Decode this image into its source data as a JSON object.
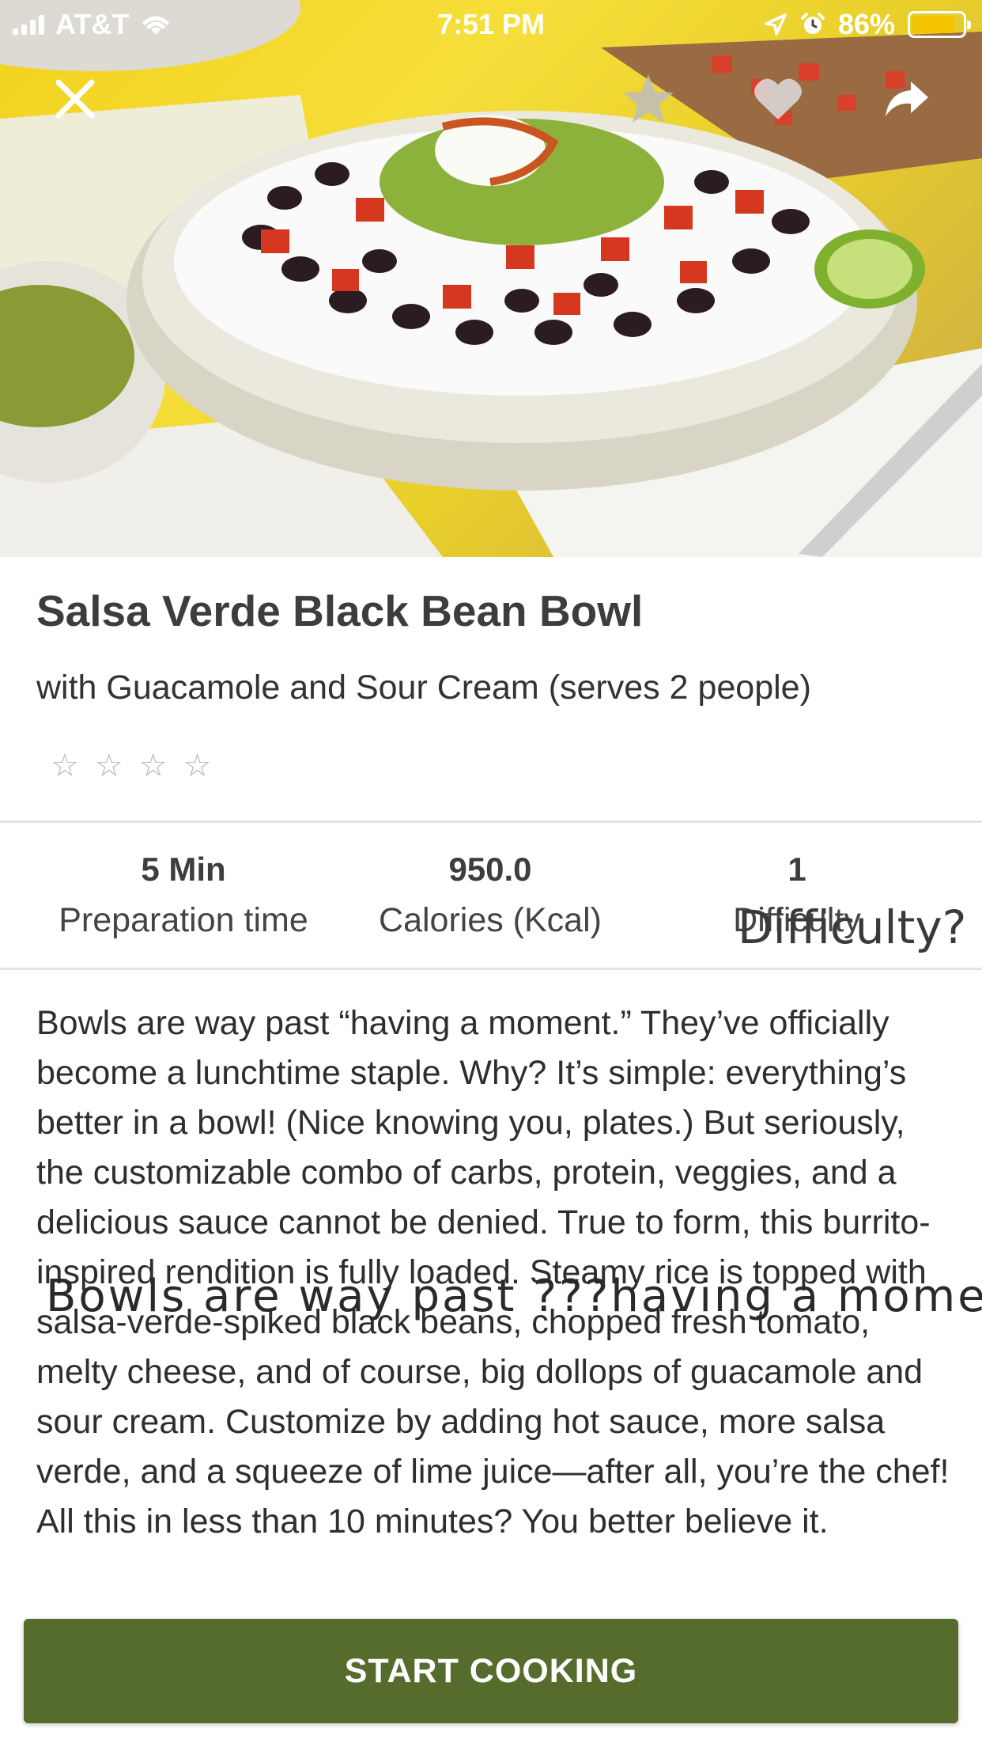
{
  "status_bar": {
    "carrier": "AT&T",
    "time": "7:51 PM",
    "battery_percent": "86%",
    "battery_level": 0.86
  },
  "header_actions": {
    "close_icon": "close-icon",
    "favorite_icon": "star-icon",
    "like_icon": "heart-icon",
    "share_icon": "share-icon"
  },
  "recipe": {
    "title": "Salsa Verde Black Bean Bowl",
    "subtitle": "with Guacamole and Sour Cream (serves 2 people)",
    "rating_stars": [
      "☆",
      "☆",
      "☆",
      "☆"
    ]
  },
  "stats": [
    {
      "value": "5 Min",
      "label": "Preparation time"
    },
    {
      "value": "950.0",
      "label": "Calories (Kcal)"
    },
    {
      "value": "1",
      "label": "Difficulty"
    }
  ],
  "overlays": {
    "difficulty": "Difficulty?",
    "description": "Bowls are way past ???having a moment"
  },
  "description": {
    "text": "Bowls are way past “having a moment.” They’ve officially become a lunchtime staple. Why? It’s simple: everything’s better in a bowl! (Nice knowing you, plates.) But seriously, the customizable combo of carbs, protein, veggies, and a delicious sauce cannot be denied. True to form, this burrito-inspired rendition is fully loaded. Steamy rice is topped with salsa-verde-spiked black beans, chopped fresh tomato, melty cheese, and of course, big dollops of guacamole and sour cream. Customize by adding hot sauce, more salsa verde, and a squeeze of lime juice—after all, you’re the chef! All this in less than 10 minutes? You better believe it."
  },
  "cta": {
    "label": "START COOKING"
  },
  "colors": {
    "cta_background": "#566c2c",
    "battery_fill": "#f5c400"
  }
}
